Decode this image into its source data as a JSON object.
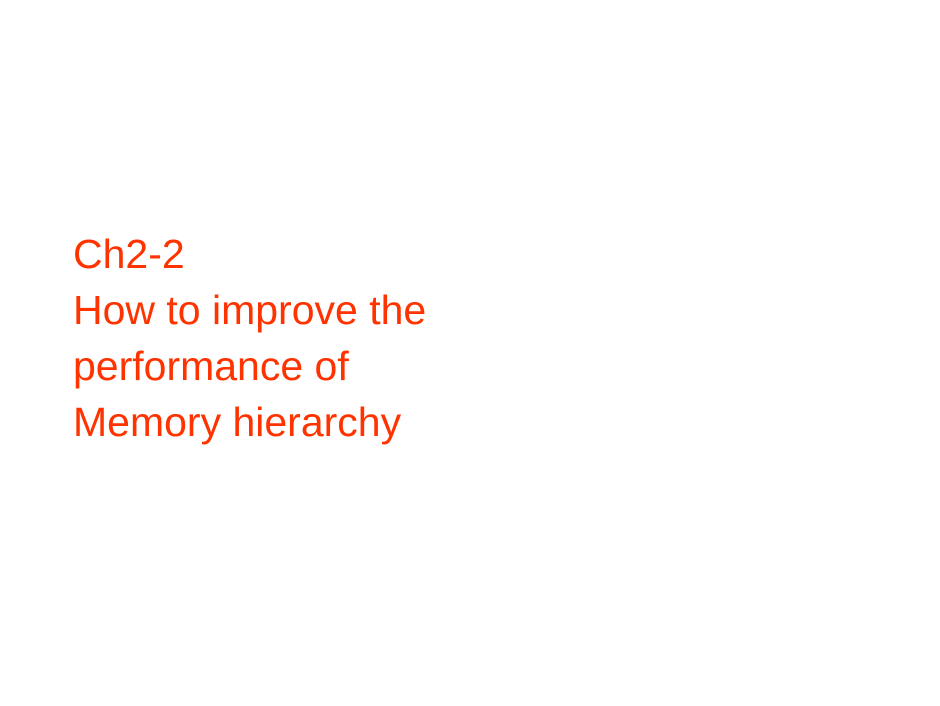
{
  "slide": {
    "lines": [
      "Ch2-2",
      "How to improve the",
      "performance of",
      "Memory hierarchy"
    ],
    "text_color": "#ff3300",
    "background_color": "#ffffff"
  }
}
